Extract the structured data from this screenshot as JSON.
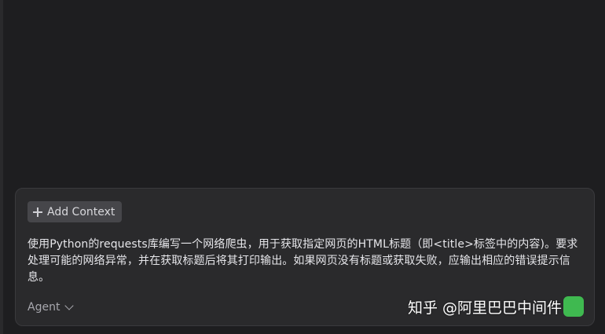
{
  "composer": {
    "add_context_label": "Add Context",
    "prompt_text": "使用Python的requests库编写一个网络爬虫，用于获取指定网页的HTML标题（即<title>标签中的内容)。要求处理可能的网络异常，并在获取标题后将其打印输出。如果网页没有标题或获取失败，应输出相应的错误提示信息。",
    "mode_label": "Agent",
    "send_color": "#3fb950"
  },
  "watermark": {
    "text": "知乎 @阿里巴巴中间件"
  },
  "icons": {
    "add": "plus-icon",
    "mode_dropdown": "chevron-down-icon"
  }
}
